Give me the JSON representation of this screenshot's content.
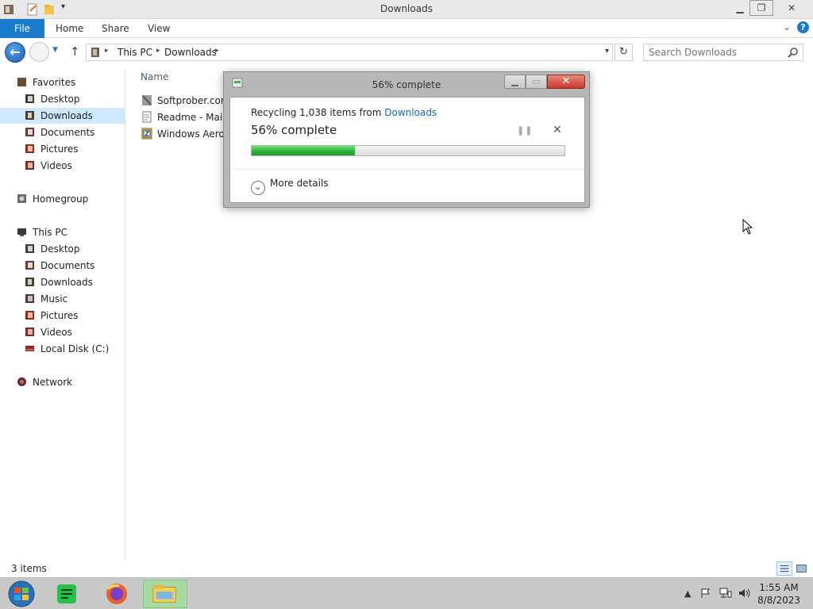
{
  "window": {
    "title": "Downloads"
  },
  "ribbon": {
    "file_label": "File",
    "tabs": [
      {
        "label": "Home"
      },
      {
        "label": "Share"
      },
      {
        "label": "View"
      }
    ],
    "help_label": "?"
  },
  "address": {
    "crumbs": [
      {
        "label": "This PC"
      },
      {
        "label": "Downloads"
      }
    ]
  },
  "search": {
    "placeholder": "Search Downloads"
  },
  "navpane": {
    "favorites_label": "Favorites",
    "favorites": [
      {
        "label": "Desktop"
      },
      {
        "label": "Downloads"
      },
      {
        "label": "Documents"
      },
      {
        "label": "Pictures"
      },
      {
        "label": "Videos"
      }
    ],
    "homegroup_label": "Homegroup",
    "thispc_label": "This PC",
    "thispc": [
      {
        "label": "Desktop"
      },
      {
        "label": "Documents"
      },
      {
        "label": "Downloads"
      },
      {
        "label": "Music"
      },
      {
        "label": "Pictures"
      },
      {
        "label": "Videos"
      },
      {
        "label": "Local Disk (C:)"
      }
    ],
    "network_label": "Network",
    "selected": "Downloads"
  },
  "content": {
    "column_name": "Name",
    "files": [
      {
        "name": "Softprober.com_",
        "icon": "archive-icon"
      },
      {
        "name": "Readme - Main T",
        "icon": "text-file-icon"
      },
      {
        "name": "Windows Aero 8",
        "icon": "zip-icon"
      }
    ]
  },
  "status": {
    "item_count": "3 items"
  },
  "dialog": {
    "title": "56% complete",
    "line_prefix": "Recycling 1,038 items from ",
    "line_link": "Downloads",
    "percent_text": "56% complete",
    "progress_fraction": 0.33,
    "more_details_label": "More details"
  },
  "taskbar": {
    "apps": [
      {
        "name": "spreadsheet-app-icon"
      },
      {
        "name": "firefox-icon"
      },
      {
        "name": "file-explorer-icon"
      }
    ],
    "time": "1:55 AM",
    "date": "8/8/2023"
  },
  "colors": {
    "accent": "#1979ca",
    "selection": "#cde8ff",
    "progress_green": "#2cb13c",
    "close_red": "#c8382a",
    "taskbar": "#c9c9c9"
  }
}
